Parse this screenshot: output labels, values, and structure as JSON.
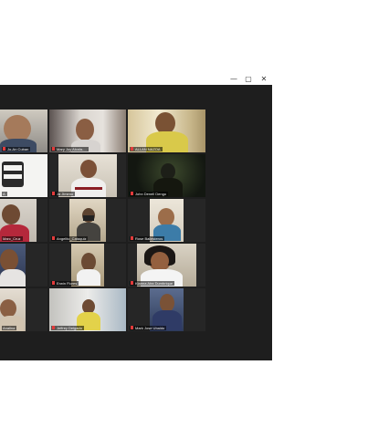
{
  "window": {
    "controls": {
      "minimize": "—",
      "maximize": "▢",
      "close": "✕"
    }
  },
  "participants": [
    {
      "name": "Jo-An Cuban"
    },
    {
      "name": "Mary Joy Alcala-..."
    },
    {
      "name": "ALLAN NAZOA"
    },
    {
      "name": "A"
    },
    {
      "name": "Ja Jimeno"
    },
    {
      "name": "John Denell Dengo"
    },
    {
      "name": "Marc_Cruz"
    },
    {
      "name": "Angelito_Cataquiz"
    },
    {
      "name": "Rose Ballesteros"
    },
    {
      "name": "Erwin Flores"
    },
    {
      "name": "Kianna Aira Dumbrique"
    },
    {
      "name": "Analina"
    },
    {
      "name": "Jeffrey Delgado"
    },
    {
      "name": "Mark Jose Ubaldo"
    }
  ]
}
